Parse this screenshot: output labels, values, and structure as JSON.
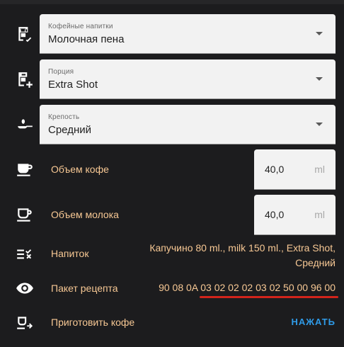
{
  "selects": [
    {
      "label": "Кофейные напитки",
      "value": "Молочная пена",
      "icon": "coffee-maker-check-icon"
    },
    {
      "label": "Порция",
      "value": "Extra Shot",
      "icon": "coffee-maker-plus-icon"
    },
    {
      "label": "Крепость",
      "value": "Средний",
      "icon": "coffee-bean-spoon-icon"
    }
  ],
  "coffee_volume": {
    "label": "Объем кофе",
    "value": "40,0",
    "unit": "ml",
    "icon": "coffee-cup-icon"
  },
  "milk_volume": {
    "label": "Объем молока",
    "value": "40,0",
    "unit": "ml",
    "icon": "coffee-outline-icon"
  },
  "drink": {
    "label": "Напиток",
    "value": "Капучино 80 ml., milk 150 ml., Extra Shot, Средний",
    "icon": "list-check-icon"
  },
  "recipe_packet": {
    "label": "Пакет рецепта",
    "value": "90 08 0A 03 02 02 02 03 02 50 00 96 00",
    "icon": "eye-icon"
  },
  "make_coffee": {
    "label": "Приготовить кофе",
    "button": "НАЖАТЬ",
    "icon": "coffee-to-go-icon"
  },
  "colors": {
    "background": "#1c1c1e",
    "label_text": "#f7c894",
    "action": "#2f9be8",
    "highlight": "#d2241b"
  }
}
